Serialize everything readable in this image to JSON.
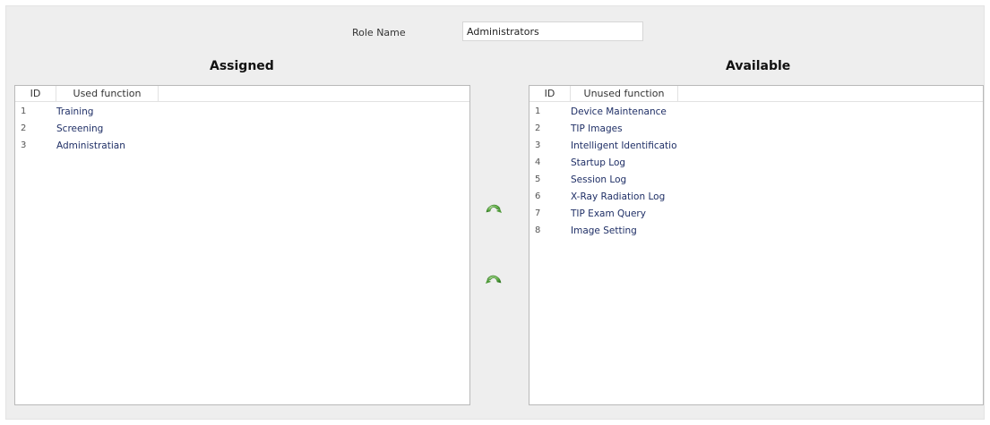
{
  "role": {
    "label": "Role Name",
    "value": "Administrators"
  },
  "assigned": {
    "title": "Assigned",
    "columns": {
      "id": "ID",
      "function": "Used function"
    },
    "rows": [
      {
        "id": "1",
        "function": "Training"
      },
      {
        "id": "2",
        "function": "Screening"
      },
      {
        "id": "3",
        "function": "Administratian"
      }
    ]
  },
  "available": {
    "title": "Available",
    "columns": {
      "id": "ID",
      "function": "Unused function"
    },
    "rows": [
      {
        "id": "1",
        "function": "Device Maintenance"
      },
      {
        "id": "2",
        "function": "TIP Images"
      },
      {
        "id": "3",
        "function": "Intelligent Identificatio"
      },
      {
        "id": "4",
        "function": "Startup Log"
      },
      {
        "id": "5",
        "function": "Session Log"
      },
      {
        "id": "6",
        "function": "X-Ray Radiation Log"
      },
      {
        "id": "7",
        "function": "TIP Exam Query"
      },
      {
        "id": "8",
        "function": "Image Setting"
      }
    ]
  },
  "buttons": {
    "assign_icon": "green-curved-arrow-left-icon",
    "unassign_icon": "green-curved-arrow-right-icon",
    "accent_color": "#4aa33a"
  }
}
